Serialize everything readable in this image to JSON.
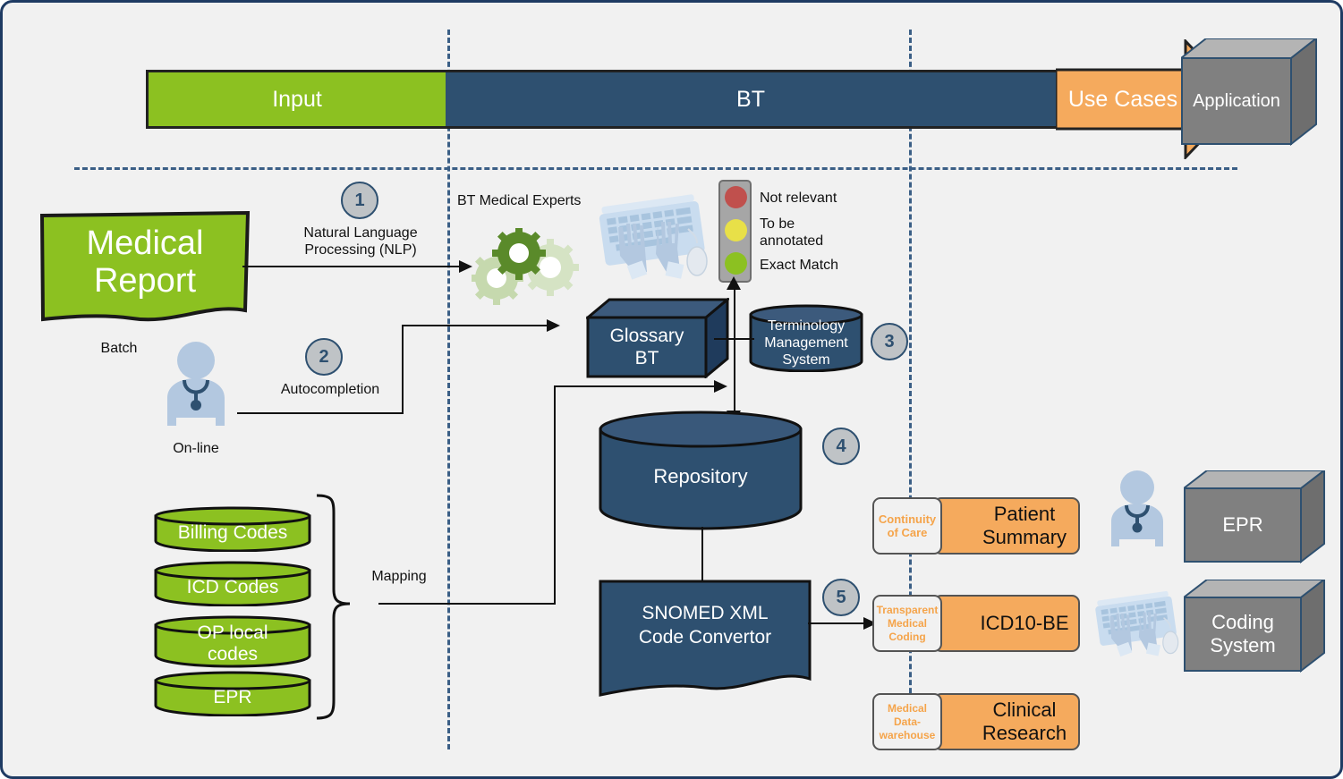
{
  "banner": {
    "input_label": "Input",
    "bt_label": "BT",
    "use_cases_label": "Use Cases",
    "colors": {
      "input": "#8cc121",
      "bt": "#2e5070",
      "use_cases": "#f5aa5d",
      "outline": "#222222"
    }
  },
  "application_box": {
    "label": "Application"
  },
  "input_section": {
    "medical_report": {
      "label": "Medical\nReport",
      "line1": "Medical",
      "line2": "Report"
    },
    "batch_label": "Batch",
    "online_label": "On-line",
    "step1": {
      "number": "1",
      "label_line1": "Natural Language",
      "label_line2": "Processing (NLP)"
    },
    "step2": {
      "number": "2",
      "label": "Autocompletion"
    },
    "mapping_label": "Mapping",
    "code_sources": [
      {
        "label": "Billing Codes"
      },
      {
        "label": "ICD Codes"
      },
      {
        "label": "OP local\ncodes",
        "line1": "OP local",
        "line2": "codes"
      },
      {
        "label": "EPR"
      }
    ]
  },
  "bt_section": {
    "medical_experts_label": "BT Medical Experts",
    "glossary": {
      "line1": "Glossary",
      "line2": "BT"
    },
    "terminology_management_system": {
      "line1": "Terminology",
      "line2": "Management",
      "line3": "System"
    },
    "repository": {
      "label": "Repository"
    },
    "snomed_converter": {
      "line1": "SNOMED XML",
      "line2": "Code Convertor"
    },
    "step3": {
      "number": "3"
    },
    "step4": {
      "number": "4"
    },
    "step5": {
      "number": "5"
    },
    "legend": {
      "items": [
        {
          "color": "#c0504d",
          "label": "Not relevant",
          "line1": "Not relevant",
          "line2": ""
        },
        {
          "color": "#e8e048",
          "label": "To be annotated",
          "line1": "To be",
          "line2": "annotated"
        },
        {
          "color": "#8cc121",
          "label": "Exact Match",
          "line1": "Exact Match",
          "line2": ""
        }
      ]
    }
  },
  "use_cases_section": {
    "rows": [
      {
        "tag_line1": "Continuity",
        "tag_line2": "of Care",
        "tag_line3": "",
        "title_line1": "Patient",
        "title_line2": "Summary"
      },
      {
        "tag_line1": "Transparent",
        "tag_line2": "Medical",
        "tag_line3": "Coding",
        "title_line1": "ICD10-BE",
        "title_line2": ""
      },
      {
        "tag_line1": "Medical",
        "tag_line2": "Data-",
        "tag_line3": "warehouse",
        "title_line1": "Clinical",
        "title_line2": "Research"
      }
    ]
  },
  "application_section": {
    "systems": [
      {
        "line1": "EPR",
        "line2": ""
      },
      {
        "line1": "Coding",
        "line2": "System"
      }
    ]
  },
  "icons": {
    "gears": "gears-icon",
    "hands_keyboard": "hands-on-keyboard-icon",
    "doctor": "doctor-avatar-icon",
    "traffic_light": "traffic-light-icon"
  }
}
